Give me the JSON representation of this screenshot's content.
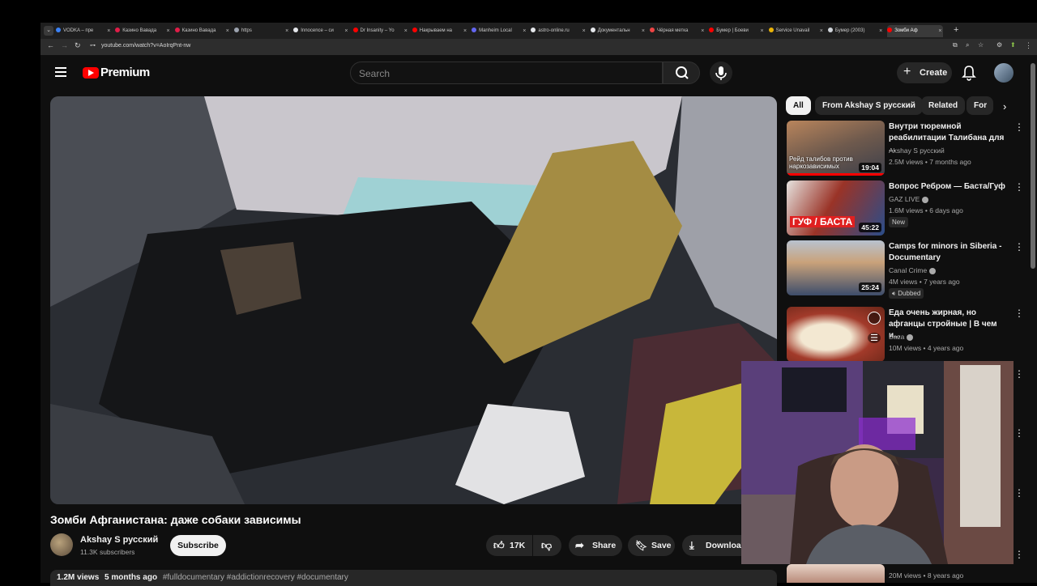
{
  "browser": {
    "tabs": [
      {
        "title": "VODKA – пре",
        "color": "#3b82f6"
      },
      {
        "title": "Казино Вавада",
        "color": "#e11d48"
      },
      {
        "title": "Казино Вавада",
        "color": "#e11d48"
      },
      {
        "title": "https",
        "color": "#9ca3af"
      },
      {
        "title": "Innocence – си",
        "color": "#e5e7eb"
      },
      {
        "title": "Dr Insanity – Yo",
        "color": "#ff0000"
      },
      {
        "title": "Накрываем на",
        "color": "#ff0000"
      },
      {
        "title": "Manheim Local",
        "color": "#6366f1"
      },
      {
        "title": "astro-online.ru",
        "color": "#e5e7eb"
      },
      {
        "title": "Документальн",
        "color": "#e5e7eb"
      },
      {
        "title": "Чёрная метка",
        "color": "#ef4444"
      },
      {
        "title": "Бумер | Боеви",
        "color": "#ff0000"
      },
      {
        "title": "Service Unavail",
        "color": "#eab308"
      },
      {
        "title": "Бумер (2003)",
        "color": "#d1d5db"
      },
      {
        "title": "Зомби Аф",
        "color": "#ff0000"
      }
    ],
    "url": "youtube.com/watch?v=AoIrqPnt-nw"
  },
  "header": {
    "brand": "Premium",
    "search_placeholder": "Search",
    "create_label": "Create"
  },
  "video": {
    "title": "Зомби Афганистана: даже собаки зависимы",
    "channel": "Akshay S русский",
    "subscribers": "11.3K subscribers",
    "subscribe_label": "Subscribe",
    "likes": "17K",
    "share_label": "Share",
    "save_label": "Save",
    "download_label": "Download",
    "views": "1.2M views",
    "age": "5 months ago",
    "hashtags": "#fulldocumentary #addictionrecovery #documentary"
  },
  "chips": [
    "All",
    "From Akshay S русский",
    "Related",
    "For"
  ],
  "recommendations": [
    {
      "title": "Внутри тюремной реабилитации Талибана для ...",
      "channel": "Akshay S русский",
      "meta": "2.5M views • 7 months ago",
      "duration": "19:04",
      "thumb_caption": "Рейд талибов против наркозависимых"
    },
    {
      "title": "Вопрос Ребром — Баста/Гуф",
      "channel": "GAZ LIVE",
      "meta": "1.6M views • 6 days ago",
      "duration": "45:22",
      "badge": "New",
      "thumb_caption": "ГУФ / БАСТА"
    },
    {
      "title": "Camps for minors in Siberia - Documentary",
      "channel": "Canal Crime",
      "meta": "4M views • 7 years ago",
      "duration": "25:24",
      "badge": "Dubbed"
    },
    {
      "title": "Еда очень жирная, но афганцы стройные | В чем и...",
      "channel": "Baza",
      "meta": "10M views • 4 years ago"
    },
    {
      "title": "",
      "channel": "",
      "meta": "20M views • 8 years ago"
    }
  ]
}
